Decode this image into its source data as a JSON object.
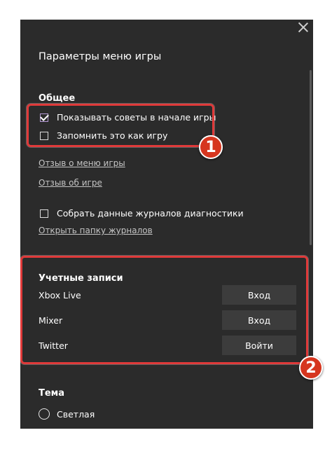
{
  "window": {
    "title": "Параметры меню игры"
  },
  "general": {
    "heading": "Общее",
    "show_tips": "Показывать советы в начале игры",
    "remember_game": "Запомнить это как игру",
    "feedback_menu": "Отзыв о меню игры",
    "feedback_game": "Отзыв об игре",
    "collect_logs": "Собрать данные журналов диагностики",
    "open_logs": "Открыть папку журналов"
  },
  "accounts": {
    "heading": "Учетные записи",
    "items": [
      {
        "label": "Xbox Live",
        "button": "Вход"
      },
      {
        "label": "Mixer",
        "button": "Вход"
      },
      {
        "label": "Twitter",
        "button": "Войти"
      }
    ]
  },
  "theme": {
    "heading": "Тема",
    "option_light": "Светлая"
  },
  "callouts": {
    "one": "1",
    "two": "2"
  },
  "colors": {
    "panel_bg": "#2b2b2b",
    "highlight": "#e03a3a",
    "badge": "#d6361f",
    "check_accent": "#b59ad6"
  }
}
